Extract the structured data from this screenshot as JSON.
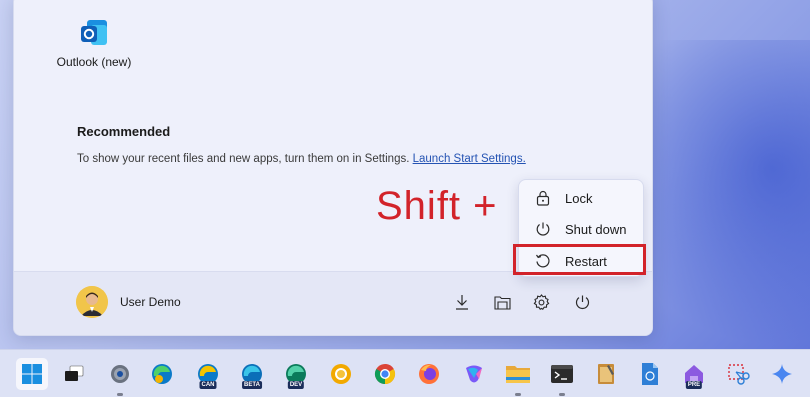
{
  "start_menu": {
    "pinned_apps": [
      {
        "label": "Outlook (new)",
        "icon": "outlook-icon"
      }
    ],
    "recommended": {
      "title": "Recommended",
      "description": "To show your recent files and new apps, turn them on in Settings. ",
      "link_text": "Launch Start Settings."
    },
    "footer": {
      "user_name": "User Demo",
      "buttons": [
        "downloads-icon",
        "file-explorer-icon",
        "settings-icon",
        "power-icon"
      ]
    }
  },
  "annotation": {
    "text": "Shift +",
    "color": "#d2232a"
  },
  "power_menu": {
    "items": [
      {
        "label": "Lock",
        "icon": "lock-icon"
      },
      {
        "label": "Shut down",
        "icon": "power-icon"
      },
      {
        "label": "Restart",
        "icon": "restart-icon"
      }
    ],
    "highlighted": "Restart"
  },
  "taskbar": {
    "items": [
      {
        "name": "start",
        "icon": "windows-logo-icon"
      },
      {
        "name": "task-view",
        "icon": "task-view-icon"
      },
      {
        "name": "settings",
        "icon": "settings-gear-icon"
      },
      {
        "name": "edge-canary",
        "icon": "edge-icon"
      },
      {
        "name": "edge-can",
        "icon": "edge-icon",
        "badge": "CAN"
      },
      {
        "name": "edge-beta",
        "icon": "edge-icon",
        "badge": "BETA"
      },
      {
        "name": "edge-dev",
        "icon": "edge-icon",
        "badge": "DEV"
      },
      {
        "name": "chrome-canary",
        "icon": "chrome-icon"
      },
      {
        "name": "chrome",
        "icon": "chrome-icon"
      },
      {
        "name": "firefox",
        "icon": "firefox-icon"
      },
      {
        "name": "copilot",
        "icon": "copilot-icon"
      },
      {
        "name": "file-explorer",
        "icon": "folder-icon"
      },
      {
        "name": "terminal",
        "icon": "terminal-icon"
      },
      {
        "name": "notepad",
        "icon": "notepad-icon"
      },
      {
        "name": "document-app",
        "icon": "document-icon"
      },
      {
        "name": "dev-home-preview",
        "icon": "dev-home-icon",
        "badge": "PRE"
      },
      {
        "name": "snipping-tool",
        "icon": "snipping-icon"
      },
      {
        "name": "copilot-sparkle",
        "icon": "sparkle-icon"
      }
    ]
  }
}
